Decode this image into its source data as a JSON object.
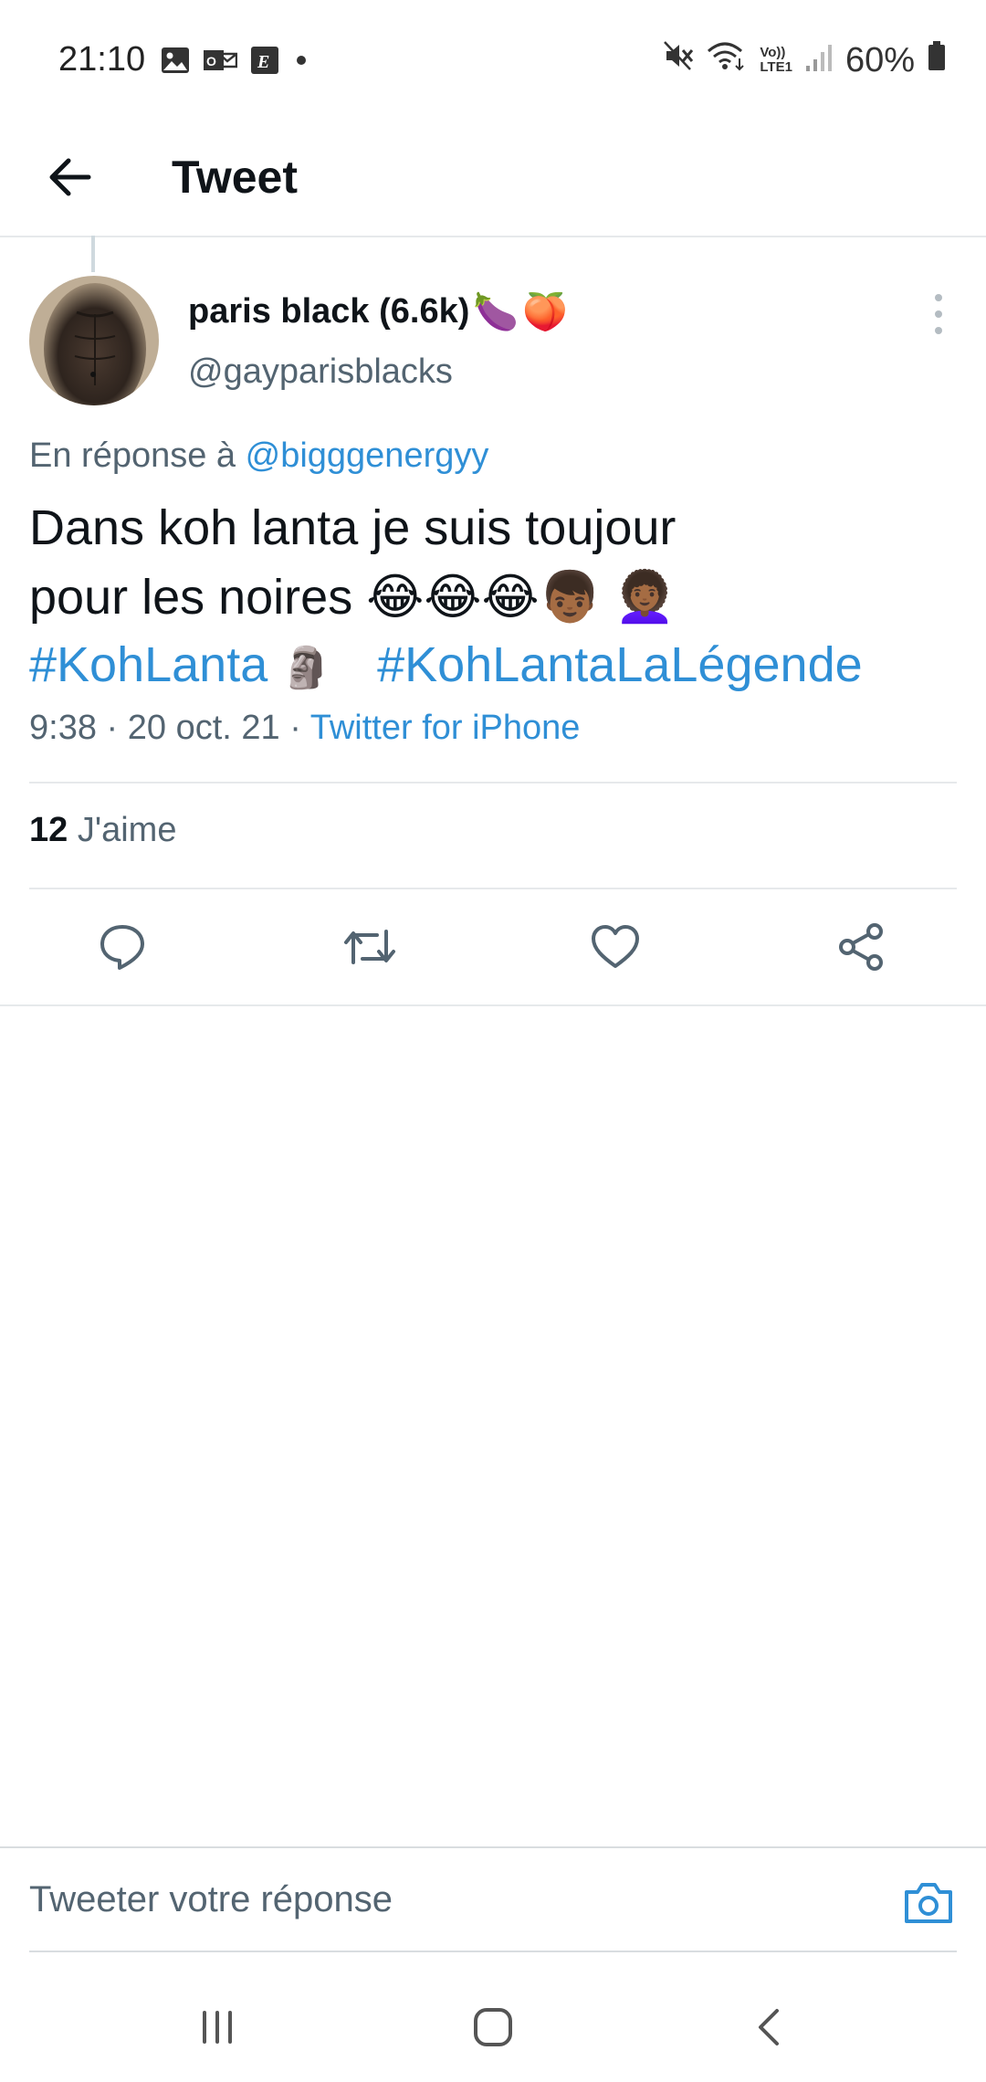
{
  "status_bar": {
    "time": "21:10",
    "left_icons": [
      "image-icon",
      "mail-icon",
      "app-e-icon",
      "dot-icon"
    ],
    "right_icons": [
      "mute-icon",
      "wifi-icon",
      "volte-icon",
      "signal-icon",
      "battery-icon"
    ],
    "volte_top": "Vo))",
    "volte_bottom": "LTE1",
    "battery": "60%"
  },
  "header": {
    "title": "Tweet"
  },
  "tweet": {
    "author": {
      "display_name": "paris black (6.6k)",
      "name_emojis": [
        "🍆",
        "🍑"
      ],
      "handle": "@gayparisblacks"
    },
    "reply_prefix": "En réponse à",
    "reply_mention": "@bigggenergyy",
    "text_line1": "Dans koh lanta je suis toujour",
    "text_line2": "pour les noires",
    "text_emojis": [
      "😂",
      "😂",
      "😂",
      "👦🏾",
      "👩🏾‍🦱"
    ],
    "hashtag1": "#KohLanta",
    "hashtag_emoji": "🗿",
    "hashtag2": "#KohLantaLaLégende",
    "time": "9:38",
    "date": "20 oct. 21",
    "separator": "·",
    "source": "Twitter for iPhone",
    "like_count": "12",
    "like_label": "J'aime"
  },
  "actions": [
    "reply-icon",
    "retweet-icon",
    "like-icon",
    "share-icon"
  ],
  "reply_bar": {
    "placeholder": "Tweeter votre réponse"
  },
  "colors": {
    "link": "#2f8fd6",
    "secondary_text": "#536471",
    "primary_text": "#0f1419",
    "divider": "#e6e9eb"
  }
}
